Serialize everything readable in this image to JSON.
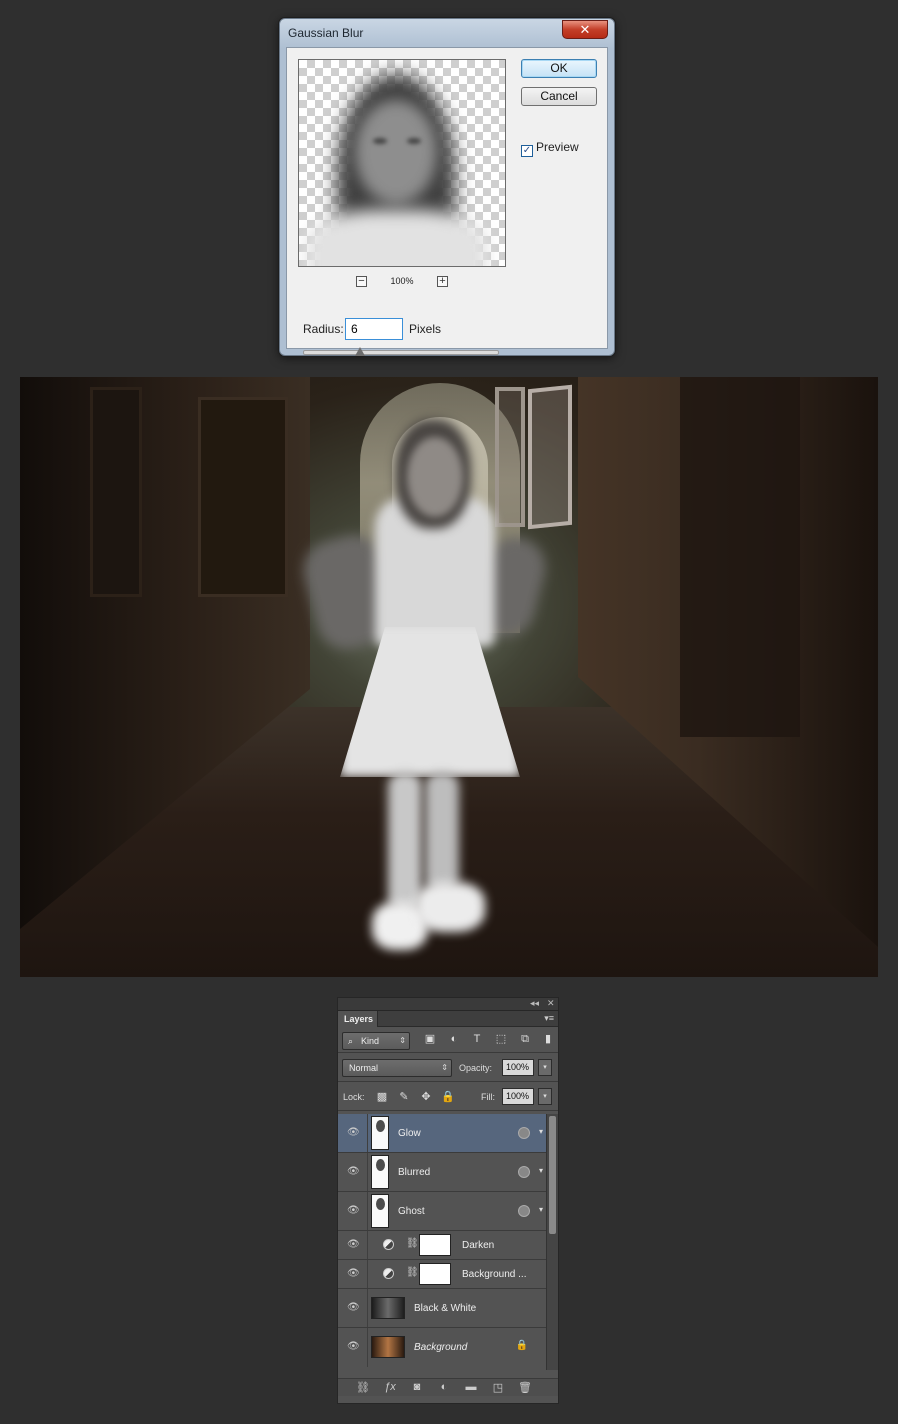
{
  "dialog": {
    "title": "Gaussian Blur",
    "close_label": "✕",
    "ok_label": "OK",
    "cancel_label": "Cancel",
    "preview_label": "Preview",
    "preview_checked": true,
    "zoom_out_label": "−",
    "zoom_level": "100%",
    "zoom_in_label": "+",
    "radius_label": "Radius:",
    "radius_value": "6",
    "pixels_label": "Pixels"
  },
  "layers_panel": {
    "collapse_label": "◂◂",
    "close_label": "✕",
    "tab_label": "Layers",
    "menu_label": "▾≡",
    "filter_kind": "Kind",
    "blend_mode": "Normal",
    "opacity_label": "Opacity:",
    "opacity_value": "100%",
    "lock_label": "Lock:",
    "fill_label": "Fill:",
    "fill_value": "100%",
    "layers": [
      {
        "name": "Glow",
        "type": "smart",
        "selected": true
      },
      {
        "name": "Blurred",
        "type": "smart",
        "selected": false
      },
      {
        "name": "Ghost",
        "type": "smart",
        "selected": false
      },
      {
        "name": "Darken",
        "type": "adjustment",
        "selected": false
      },
      {
        "name": "Background ...",
        "type": "adjustment",
        "selected": false
      },
      {
        "name": "Black & White",
        "type": "image",
        "selected": false
      },
      {
        "name": "Background",
        "type": "locked",
        "selected": false
      }
    ]
  }
}
